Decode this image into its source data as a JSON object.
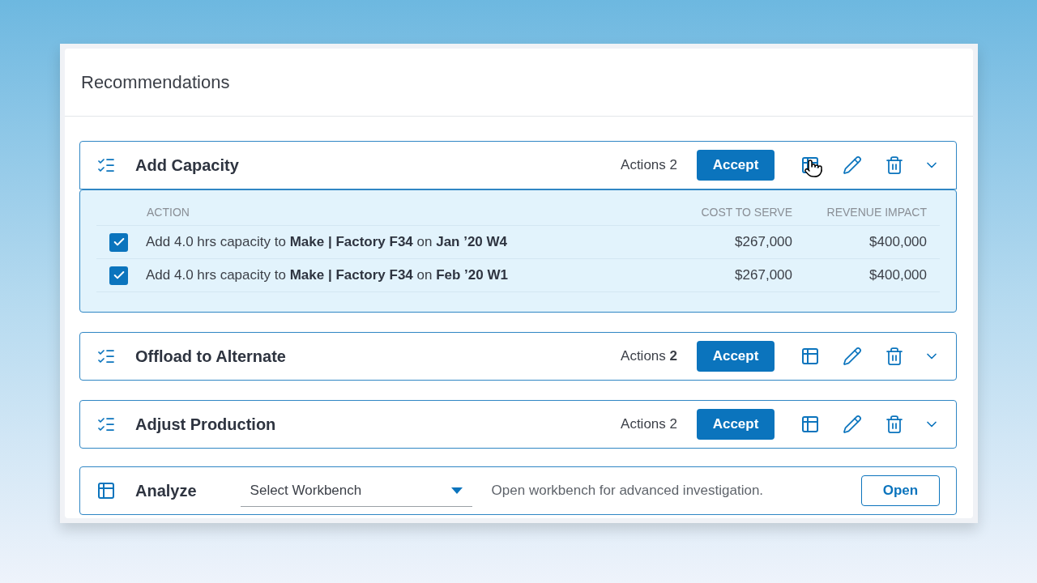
{
  "panel": {
    "title": "Recommendations"
  },
  "groups": [
    {
      "title": "Add Capacity",
      "actions_label": "Actions 2",
      "accept": "Accept",
      "expanded": true,
      "cursor": true,
      "columns": [
        "ACTION",
        "COST TO SERVE",
        "REVENUE IMPACT"
      ],
      "rows": [
        {
          "checked": true,
          "action": "Add 4.0 hrs capacity to **Make | Factory F34** on **Jan ’20 W4**",
          "cost": "$267,000",
          "revenue": "$400,000"
        },
        {
          "checked": true,
          "action": "Add 4.0 hrs capacity to **Make | Factory F34** on **Feb ’20 W1**",
          "cost": "$267,000",
          "revenue": "$400,000"
        }
      ]
    },
    {
      "title": "Offload to Alternate",
      "actions_label": "Actions **2**",
      "accept": "Accept",
      "expanded": false,
      "cursor": false
    },
    {
      "title": "Adjust Production",
      "actions_label": "Actions 2",
      "accept": "Accept",
      "expanded": false,
      "cursor": false
    }
  ],
  "analyze": {
    "title": "Analyze",
    "select": "Select Workbench",
    "hint": "Open workbench for advanced investigation.",
    "button": "Open"
  }
}
